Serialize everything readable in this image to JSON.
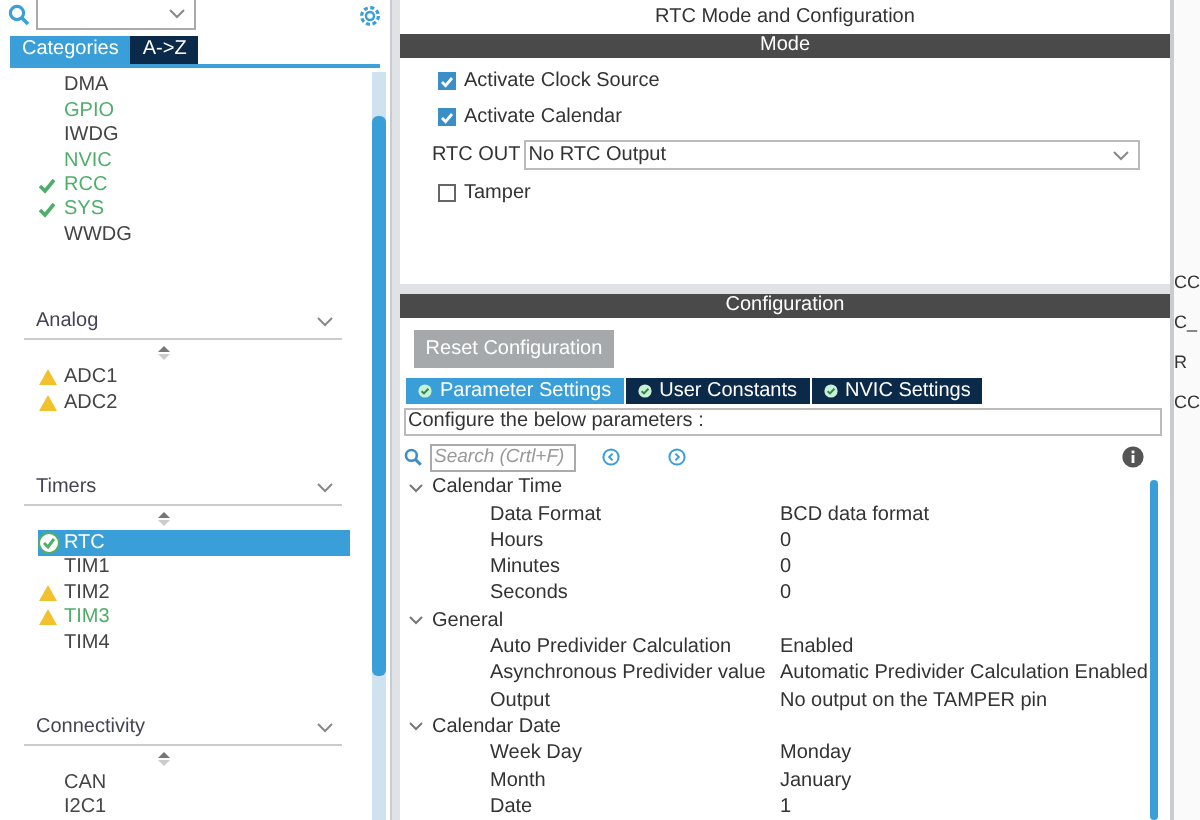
{
  "sidebar": {
    "tabs": [
      {
        "label": "Categories",
        "selected": true
      },
      {
        "label": "A->Z",
        "selected": false
      }
    ],
    "top_items": [
      {
        "label": "DMA",
        "kind": "none",
        "configured": false,
        "selected": false
      },
      {
        "label": "GPIO",
        "kind": "none",
        "configured": true,
        "selected": false
      },
      {
        "label": "IWDG",
        "kind": "none",
        "configured": false,
        "selected": false
      },
      {
        "label": "NVIC",
        "kind": "none",
        "configured": true,
        "selected": false
      },
      {
        "label": "RCC",
        "kind": "check",
        "configured": true,
        "selected": false
      },
      {
        "label": "SYS",
        "kind": "check",
        "configured": true,
        "selected": false
      },
      {
        "label": "WWDG",
        "kind": "none",
        "configured": false,
        "selected": false
      }
    ],
    "sections": [
      {
        "title": "Analog",
        "items": [
          {
            "label": "ADC1",
            "kind": "warning",
            "configured": false,
            "selected": false
          },
          {
            "label": "ADC2",
            "kind": "warning",
            "configured": false,
            "selected": false
          }
        ]
      },
      {
        "title": "Timers",
        "items": [
          {
            "label": "RTC",
            "kind": "check",
            "configured": true,
            "selected": true
          },
          {
            "label": "TIM1",
            "kind": "none",
            "configured": false,
            "selected": false
          },
          {
            "label": "TIM2",
            "kind": "warning",
            "configured": false,
            "selected": false
          },
          {
            "label": "TIM3",
            "kind": "warning",
            "configured": true,
            "selected": false
          },
          {
            "label": "TIM4",
            "kind": "none",
            "configured": false,
            "selected": false
          }
        ]
      },
      {
        "title": "Connectivity",
        "items": [
          {
            "label": "CAN",
            "kind": "none",
            "configured": false,
            "selected": false
          },
          {
            "label": "I2C1",
            "kind": "none",
            "configured": false,
            "selected": false
          }
        ]
      }
    ]
  },
  "main": {
    "title": "RTC Mode and Configuration",
    "mode": {
      "header": "Mode",
      "options": [
        {
          "label": "Activate Clock Source",
          "checked": true
        },
        {
          "label": "Activate Calendar",
          "checked": true
        }
      ],
      "rtc_out": {
        "label": "RTC OUT",
        "value": "No RTC Output"
      },
      "tamper": {
        "label": "Tamper",
        "checked": false
      }
    },
    "configuration": {
      "header": "Configuration",
      "reset_button": "Reset Configuration",
      "tabs": [
        {
          "label": "Parameter Settings",
          "selected": true
        },
        {
          "label": "User Constants",
          "selected": false
        },
        {
          "label": "NVIC Settings",
          "selected": false
        }
      ],
      "hint": "Configure the below parameters :",
      "search": {
        "placeholder": "Search (Crtl+F)"
      },
      "groups": [
        {
          "title": "Calendar Time",
          "expanded": true,
          "children": [
            {
              "name": "Data Format",
              "value": "BCD data format"
            },
            {
              "name": "Hours",
              "value": "0"
            },
            {
              "name": "Minutes",
              "value": "0"
            },
            {
              "name": "Seconds",
              "value": "0"
            }
          ]
        },
        {
          "title": "General",
          "expanded": true,
          "children": [
            {
              "name": "Auto Predivider Calculation",
              "value": "Enabled"
            },
            {
              "name": "Asynchronous Predivider value",
              "value": "Automatic Predivider Calculation Enabled"
            },
            {
              "name": "Output",
              "value": "No output on the TAMPER pin"
            }
          ]
        },
        {
          "title": "Calendar Date",
          "expanded": true,
          "children": [
            {
              "name": "Week Day",
              "value": "Monday"
            },
            {
              "name": "Month",
              "value": "January"
            },
            {
              "name": "Date",
              "value": "1"
            }
          ]
        }
      ]
    }
  },
  "right_edge": [
    {
      "text": "CC"
    },
    {
      "text": "C_"
    },
    {
      "text": "R"
    },
    {
      "text": "CC"
    }
  ]
}
